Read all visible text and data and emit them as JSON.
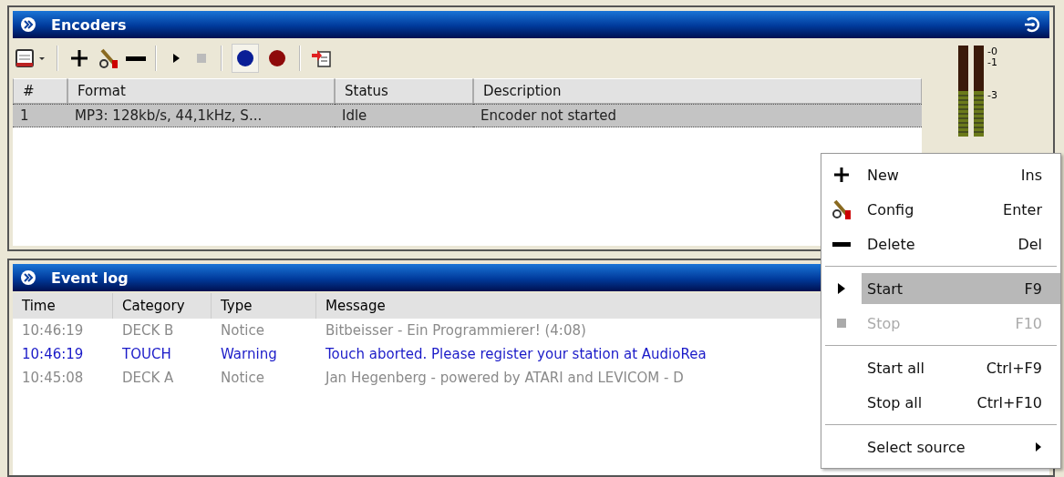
{
  "encoders": {
    "title": "Encoders",
    "columns": [
      "#",
      "Format",
      "Status",
      "Description"
    ],
    "rows": [
      {
        "cells": [
          "1",
          "MP3: 128kb/s, 44,1kHz, S...",
          "Idle",
          "Encoder not started"
        ],
        "selected": true
      }
    ],
    "meter_labels": [
      "-0",
      "-1",
      "-3"
    ]
  },
  "event_log": {
    "title": "Event log",
    "columns": [
      "Time",
      "Category",
      "Type",
      "Message"
    ],
    "rows": [
      {
        "kind": "notice",
        "cells": [
          "10:46:19",
          "DECK B",
          "Notice",
          "Bitbeisser - Ein Programmierer! (4:08)"
        ]
      },
      {
        "kind": "warning",
        "cells": [
          "10:46:19",
          "TOUCH",
          "Warning",
          "Touch aborted. Please register your station at AudioRea"
        ]
      },
      {
        "kind": "notice",
        "cells": [
          "10:45:08",
          "DECK A",
          "Notice",
          "Jan Hegenberg - powered by ATARI and LEVICOM - D"
        ]
      }
    ]
  },
  "context_menu": [
    {
      "kind": "plus",
      "label": "New",
      "shortcut": "Ins",
      "selected": false,
      "disabled": false
    },
    {
      "kind": "tools",
      "label": "Config",
      "shortcut": "Enter",
      "selected": false,
      "disabled": false
    },
    {
      "kind": "minus",
      "label": "Delete",
      "shortcut": "Del",
      "selected": false,
      "disabled": false
    },
    {
      "kind": "separator"
    },
    {
      "kind": "play",
      "label": "Start",
      "shortcut": "F9",
      "selected": true,
      "disabled": false
    },
    {
      "kind": "stop",
      "label": "Stop",
      "shortcut": "F10",
      "selected": false,
      "disabled": true
    },
    {
      "kind": "separator"
    },
    {
      "kind": "item",
      "label": "Start all",
      "shortcut": "Ctrl+F9",
      "selected": false,
      "disabled": false
    },
    {
      "kind": "item",
      "label": "Stop all",
      "shortcut": "Ctrl+F10",
      "selected": false,
      "disabled": false
    },
    {
      "kind": "separator"
    },
    {
      "kind": "submenu",
      "label": "Select source",
      "selected": false,
      "disabled": false
    }
  ]
}
